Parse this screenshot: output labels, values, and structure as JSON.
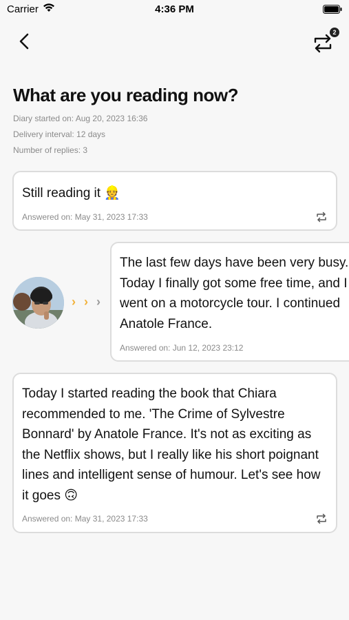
{
  "status_bar": {
    "carrier": "Carrier",
    "time": "4:36 PM"
  },
  "header": {
    "badge_count": "2"
  },
  "diary": {
    "title": "What are you reading now?",
    "started": "Diary started on: Aug 20, 2023 16:36",
    "interval": "Delivery interval: 12 days",
    "replies": "Number of replies: 3"
  },
  "entries": [
    {
      "text": "Still reading it 👷",
      "date": "Answered on: May 31, 2023 17:33"
    },
    {
      "text": "The last few days have been very busy. Today I finally got some free time, and I went on a motorcycle tour. I continued Anatole France.",
      "date": "Answered on: Jun 12, 2023 23:12"
    },
    {
      "text": "Today I started reading the book that Chiara recommended to me. 'The Crime of Sylvestre Bonnard' by Anatole France. It's not as exciting as the Netflix shows, but I really like his short poignant lines and intelligent sense of humour. Let's see how it goes 🙃",
      "date": "Answered on: May 31, 2023 17:33"
    }
  ],
  "colors": {
    "accent_chevron": "#f2b23a",
    "muted_chevron": "#9a9a9a",
    "border": "#dcdcdc"
  }
}
